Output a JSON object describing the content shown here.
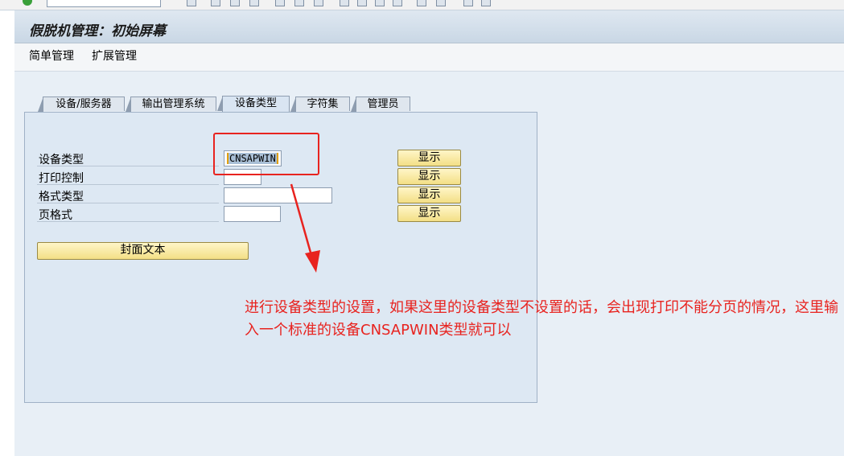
{
  "window": {
    "title": "假脱机管理：初始屏幕"
  },
  "menu": {
    "items": [
      "简单管理",
      "扩展管理"
    ]
  },
  "tabs": [
    {
      "label": "设备/服务器",
      "active": false
    },
    {
      "label": "输出管理系统",
      "active": false
    },
    {
      "label": "设备类型",
      "active": true
    },
    {
      "label": "字符集",
      "active": false
    },
    {
      "label": "管理员",
      "active": false
    }
  ],
  "form": {
    "fields": [
      {
        "label": "设备类型",
        "value": "CNSAPWIN",
        "button": "显示"
      },
      {
        "label": "打印控制",
        "value": "",
        "button": "显示"
      },
      {
        "label": "格式类型",
        "value": "",
        "button": "显示"
      },
      {
        "label": "页格式",
        "value": "",
        "button": "显示"
      }
    ],
    "cover_text_button": "封面文本"
  },
  "annotation": {
    "text": "进行设备类型的设置，如果这里的设备类型不设置的话，会出现打印不能分页的情况，这里输入一个标准的设备CNSAPWIN类型就可以",
    "color": "#e8231f"
  },
  "colors": {
    "background": "#e6eef6",
    "button": "#f3df86",
    "accent_red": "#e8231f"
  }
}
